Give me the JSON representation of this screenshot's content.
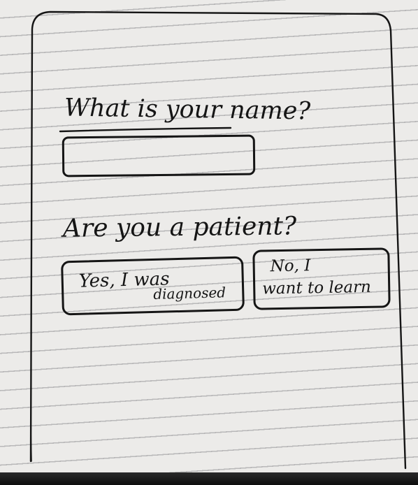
{
  "form": {
    "name_question": "What is your name?",
    "patient_question": "Are you a patient?",
    "options": [
      {
        "line1": "Yes, I was",
        "line2": "diagnosed"
      },
      {
        "line1": "No, I",
        "line2": "want to learn"
      }
    ]
  },
  "colors": {
    "ink": "#151515",
    "paper": "#ecebe9",
    "rule_lines": "#b9b8b9"
  }
}
